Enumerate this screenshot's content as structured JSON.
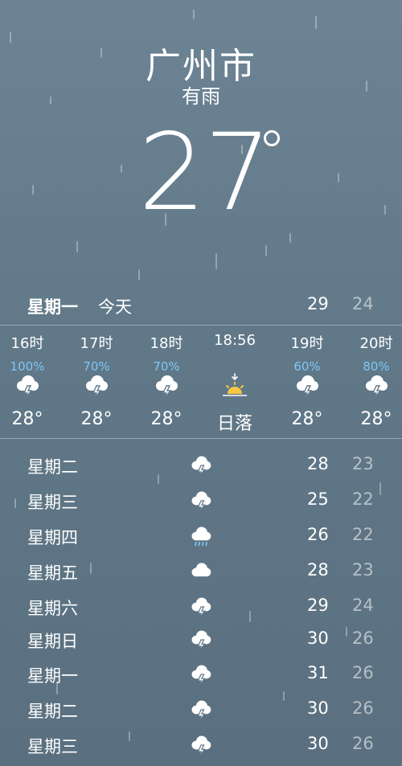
{
  "location": {
    "city": "广州市",
    "condition": "有雨",
    "temperature": "27"
  },
  "today": {
    "day": "星期一",
    "label": "今天",
    "high": "29",
    "low": "24"
  },
  "hourly": [
    {
      "time": "16时",
      "precip": "100%",
      "icon": "thunderstorm-icon",
      "temp": "28°"
    },
    {
      "time": "17时",
      "precip": "70%",
      "icon": "thunderstorm-icon",
      "temp": "28°"
    },
    {
      "time": "18时",
      "precip": "70%",
      "icon": "thunderstorm-icon",
      "temp": "28°"
    },
    {
      "time": "18:56",
      "precip": "",
      "icon": "sunset-icon",
      "temp": "日落"
    },
    {
      "time": "19时",
      "precip": "60%",
      "icon": "thunderstorm-icon",
      "temp": "28°"
    },
    {
      "time": "20时",
      "precip": "80%",
      "icon": "thunderstorm-icon",
      "temp": "28°"
    }
  ],
  "daily": [
    {
      "day": "星期二",
      "icon": "thunderstorm-icon",
      "high": "28",
      "low": "23"
    },
    {
      "day": "星期三",
      "icon": "thunderstorm-icon",
      "high": "25",
      "low": "22"
    },
    {
      "day": "星期四",
      "icon": "rain-cloud-icon",
      "high": "26",
      "low": "22"
    },
    {
      "day": "星期五",
      "icon": "cloud-icon",
      "high": "28",
      "low": "23"
    },
    {
      "day": "星期六",
      "icon": "thunderstorm-icon",
      "high": "29",
      "low": "24"
    },
    {
      "day": "星期日",
      "icon": "thunderstorm-icon",
      "high": "30",
      "low": "26"
    },
    {
      "day": "星期一",
      "icon": "thunderstorm-icon",
      "high": "31",
      "low": "26"
    },
    {
      "day": "星期二",
      "icon": "thunderstorm-icon",
      "high": "30",
      "low": "26"
    },
    {
      "day": "星期三",
      "icon": "thunderstorm-icon",
      "high": "30",
      "low": "26"
    }
  ],
  "colors": {
    "precip": "#7ec7f5",
    "sun": "#f5c842",
    "background": "#627989"
  }
}
